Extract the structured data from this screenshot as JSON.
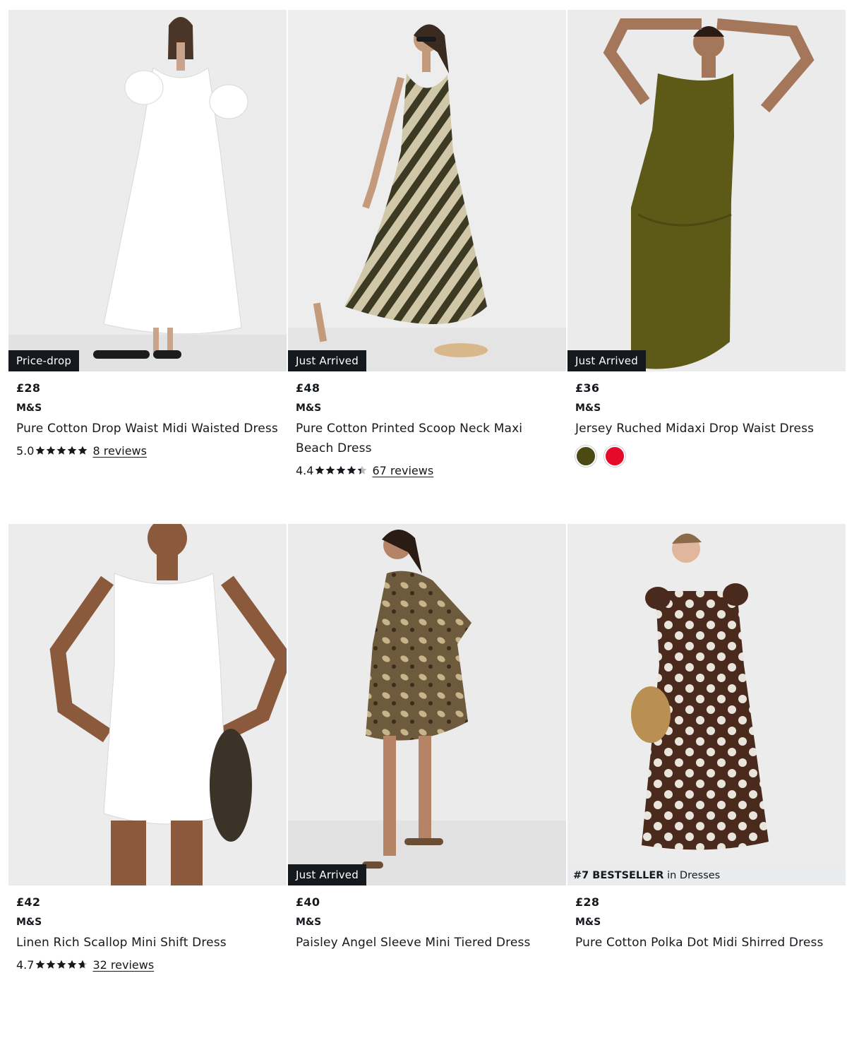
{
  "products": [
    {
      "badge": "Price-drop",
      "price": "£28",
      "brand": "M&S",
      "title": "Pure Cotton Drop Waist Midi Waisted Dress",
      "rating": "5.0",
      "rating_value": 5.0,
      "reviews": "8 reviews",
      "dress_color": "#ffffff"
    },
    {
      "badge": "Just Arrived",
      "price": "£48",
      "brand": "M&S",
      "title": "Pure Cotton Printed Scoop Neck Maxi Beach Dress",
      "rating": "4.4",
      "rating_value": 4.4,
      "reviews": "67 reviews",
      "dress_color": "#6b6540"
    },
    {
      "badge": "Just Arrived",
      "price": "£36",
      "brand": "M&S",
      "title": "Jersey Ruched Midaxi Drop Waist Dress",
      "swatches": [
        "#4a4a12",
        "#e60a2a"
      ],
      "dress_color": "#5c5a16"
    },
    {
      "price": "£42",
      "brand": "M&S",
      "title": "Linen Rich Scallop Mini Shift Dress",
      "rating": "4.7",
      "rating_value": 4.7,
      "reviews": "32 reviews",
      "dress_color": "#ffffff"
    },
    {
      "badge": "Just Arrived",
      "price": "£40",
      "brand": "M&S",
      "title": "Paisley Angel Sleeve Mini Tiered Dress",
      "dress_color": "#7a6446"
    },
    {
      "bestseller_rank": "#7 BESTSELLER",
      "bestseller_suffix": " in Dresses",
      "price": "£28",
      "brand": "M&S",
      "title": "Pure Cotton Polka Dot Midi Shirred Dress",
      "dress_color": "#4a2a1c"
    }
  ]
}
